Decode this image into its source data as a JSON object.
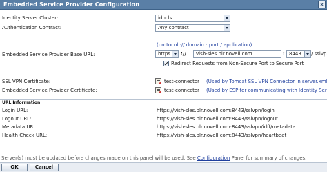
{
  "window": {
    "title": "Embedded Service Provider Configuration"
  },
  "form": {
    "cluster_label": "Identity Server Cluster:",
    "cluster_value": "idpcls",
    "auth_contract_label": "Authentication Contract:",
    "auth_contract_value": "Any contract",
    "url_hint": "(protocol :// domain : port / application)",
    "base_url_label": "Embedded Service Provider Base URL:",
    "protocol_value": "https",
    "protocol_sep": "://",
    "domain_value": "vish-sles.blr.novell.com",
    "port_sep": ":",
    "port_value": "8443",
    "application_value": "/ sslvpn",
    "redirect_label": "Redirect Requests from Non-Secure Port to Secure Port",
    "redirect_checked": true,
    "ssl_cert_label": "SSL VPN Certificate:",
    "ssl_cert_value": "test-connector",
    "ssl_cert_hint": "(Used by Tomcat SSL VPN Connector in server.xml file)",
    "esp_cert_label": "Embedded Service Provider Certificate:",
    "esp_cert_value": "test-connector",
    "esp_cert_hint": "(Used by ESP for communicating with Identity Server)"
  },
  "url_info": {
    "header": "URL Information",
    "rows": [
      {
        "label": "Login URL:",
        "value": "https://vish-sles.blr.novell.com:8443/sslvpn/login"
      },
      {
        "label": "Logout URL:",
        "value": "https://vish-sles.blr.novell.com:8443/sslvpn/logout"
      },
      {
        "label": "Metadata URL:",
        "value": "https://vish-sles.blr.novell.com:8443/sslvpn/idff/metadata"
      },
      {
        "label": "Health Check URL:",
        "value": "https://vish-sles.blr.novell.com:8443/sslvpn/heartbeat"
      }
    ]
  },
  "footer": {
    "msg_before": "Server(s) must be updated before changes made on this panel will be used. See ",
    "msg_link": "Configuration",
    "msg_after": " Panel for summary of changes."
  },
  "buttons": {
    "ok": "OK",
    "cancel": "Cancel"
  }
}
